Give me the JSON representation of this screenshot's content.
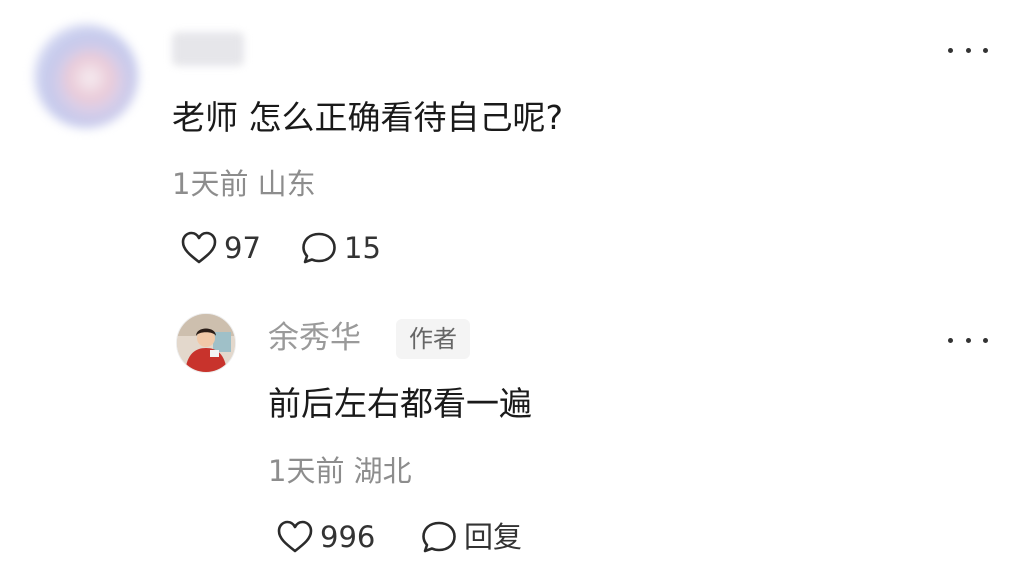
{
  "comment": {
    "text": "老师 怎么正确看待自己呢?",
    "meta": "1天前 山东",
    "likes": "97",
    "replies": "15"
  },
  "reply": {
    "username": "余秀华",
    "badge": "作者",
    "text": "前后左右都看一遍",
    "meta": "1天前 湖北",
    "likes": "996",
    "reply_label": "回复"
  },
  "icons": {
    "like": "heart-icon",
    "comment": "speech-bubble-icon",
    "more": "more-horizontal-icon"
  }
}
